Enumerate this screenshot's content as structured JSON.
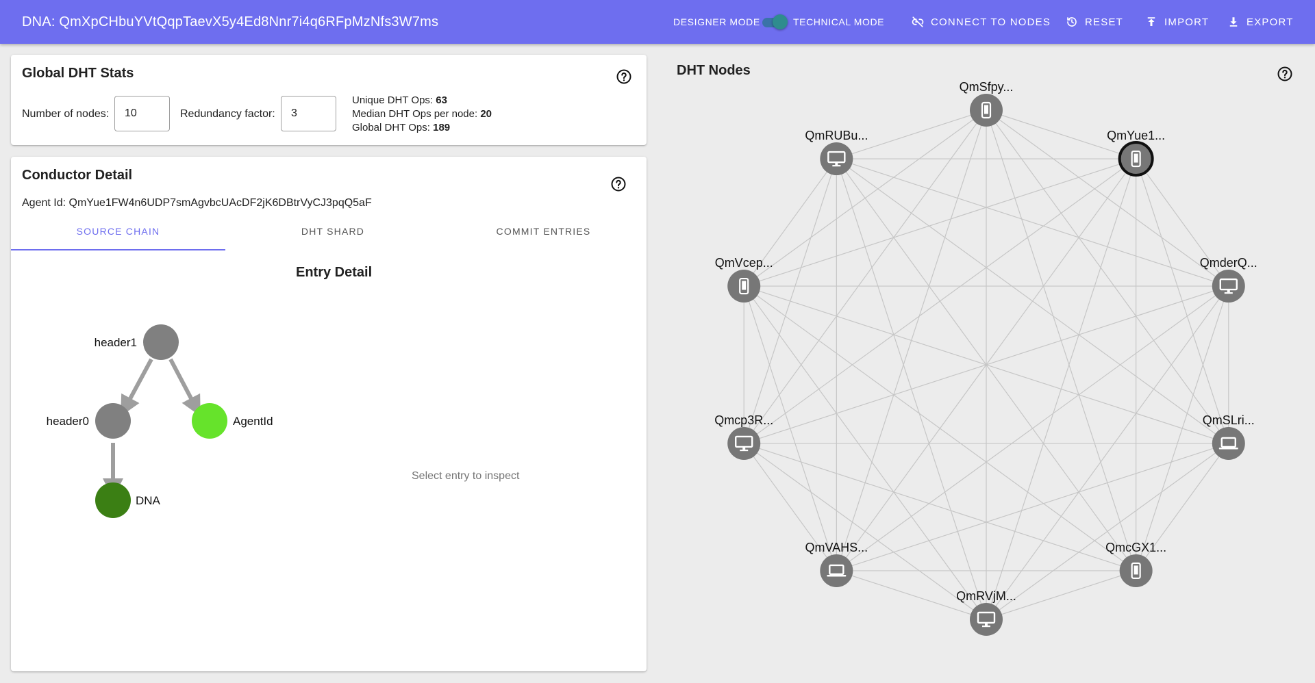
{
  "header": {
    "dna_title": "DNA: QmXpCHbuYVtQqpTaevX5y4Ed8Nnr7i4q6RFpMzNfs3W7ms",
    "designer_mode_label": "DESIGNER MODE",
    "technical_mode_label": "TECHNICAL MODE",
    "toggle_on": true,
    "connect_label": "CONNECT TO NODES",
    "reset_label": "RESET",
    "import_label": "IMPORT",
    "export_label": "EXPORT"
  },
  "global_stats": {
    "title": "Global DHT Stats",
    "nodes_label": "Number of nodes:",
    "nodes_value": "10",
    "redundancy_label": "Redundancy factor:",
    "redundancy_value": "3",
    "unique_ops_label": "Unique DHT Ops:",
    "unique_ops_value": "63",
    "median_ops_label": "Median DHT Ops per node:",
    "median_ops_value": "20",
    "global_ops_label": "Global DHT Ops:",
    "global_ops_value": "189"
  },
  "conductor": {
    "title": "Conductor Detail",
    "agent_id_label": "Agent Id:",
    "agent_id_value": "QmYue1FW4n6UDP7smAgvbcUAcDF2jK6DBtrVyCJ3pqQ5aF",
    "tabs": [
      {
        "label": "SOURCE CHAIN",
        "active": true
      },
      {
        "label": "DHT SHARD",
        "active": false
      },
      {
        "label": "COMMIT ENTRIES",
        "active": false
      }
    ],
    "entry_detail_title": "Entry Detail",
    "entry_placeholder": "Select entry to inspect",
    "chain_nodes": [
      {
        "label": "header1",
        "color": "#808080"
      },
      {
        "label": "header0",
        "color": "#808080"
      },
      {
        "label": "AgentId",
        "color": "#66e32b"
      },
      {
        "label": "DNA",
        "color": "#3b7f14"
      }
    ]
  },
  "dht_nodes": {
    "title": "DHT Nodes",
    "node_color": "#777777",
    "nodes": [
      {
        "label": "QmSfpy...",
        "icon": "phone-icon",
        "selected": false
      },
      {
        "label": "QmYue1...",
        "icon": "phone-icon",
        "selected": true
      },
      {
        "label": "QmderQ...",
        "icon": "desktop-icon",
        "selected": false
      },
      {
        "label": "QmSLri...",
        "icon": "laptop-icon",
        "selected": false
      },
      {
        "label": "QmcGX1...",
        "icon": "phone-icon",
        "selected": false
      },
      {
        "label": "QmRVjM...",
        "icon": "desktop-icon",
        "selected": false
      },
      {
        "label": "QmVAHS...",
        "icon": "laptop-icon",
        "selected": false
      },
      {
        "label": "Qmcp3R...",
        "icon": "desktop-icon",
        "selected": false
      },
      {
        "label": "QmVcep...",
        "icon": "phone-icon",
        "selected": false
      },
      {
        "label": "QmRUBu...",
        "icon": "desktop-icon",
        "selected": false
      }
    ]
  }
}
